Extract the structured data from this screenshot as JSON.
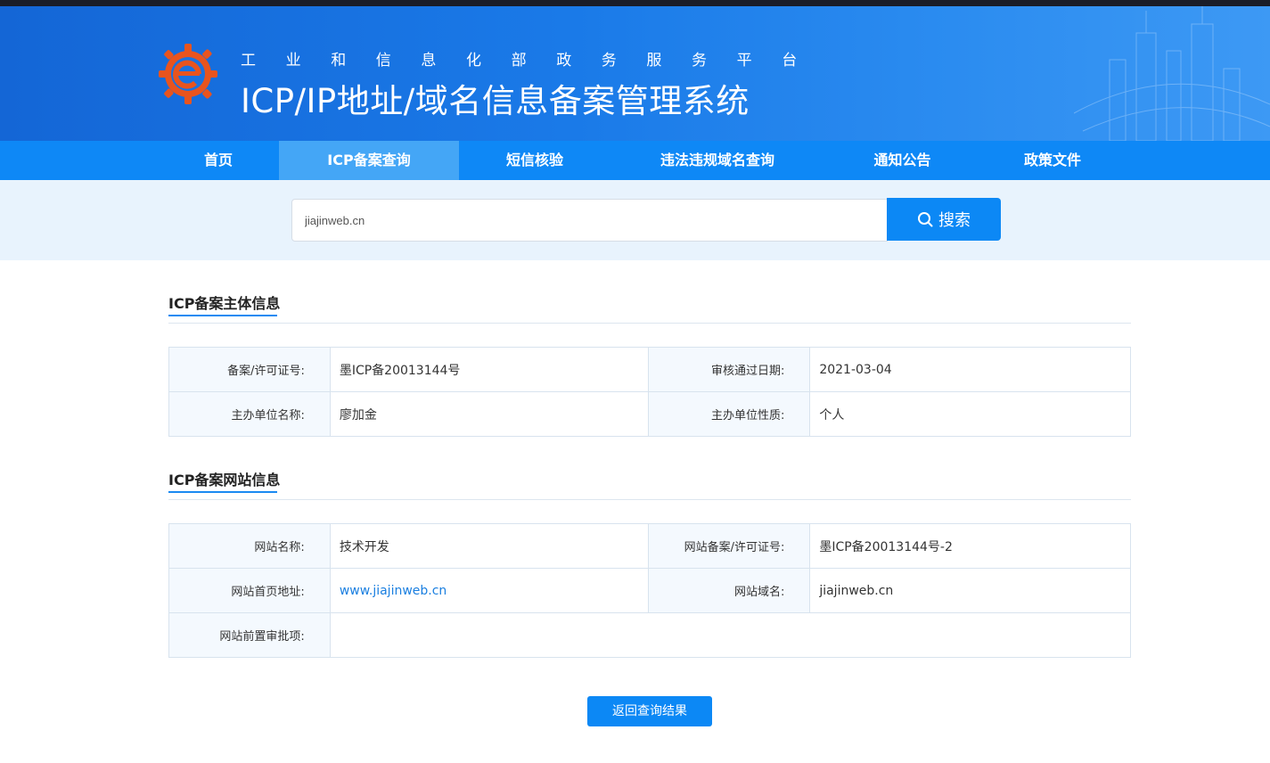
{
  "header": {
    "subtitle": "工业和信息化部政务服务平台",
    "title": "ICP/IP地址/域名信息备案管理系统"
  },
  "nav": {
    "items": [
      "首页",
      "ICP备案查询",
      "短信核验",
      "违法违规域名查询",
      "通知公告",
      "政策文件"
    ],
    "active": "ICP备案查询"
  },
  "search": {
    "value": "jiajinweb.cn",
    "button_label": "搜索"
  },
  "subject_section": {
    "title": "ICP备案主体信息",
    "license_label": "备案/许可证号:",
    "license_value": "墨ICP备20013144号",
    "approve_date_label": "审核通过日期:",
    "approve_date_value": "2021-03-04",
    "org_name_label": "主办单位名称:",
    "org_name_value": "廖加金",
    "org_type_label": "主办单位性质:",
    "org_type_value": "个人"
  },
  "site_section": {
    "title": "ICP备案网站信息",
    "site_name_label": "网站名称:",
    "site_name_value": "技术开发",
    "site_license_label": "网站备案/许可证号:",
    "site_license_value": "墨ICP备20013144号-2",
    "homepage_label": "网站首页地址:",
    "homepage_value": "www.jiajinweb.cn",
    "domain_label": "网站域名:",
    "domain_value": "jiajinweb.cn",
    "preapproval_label": "网站前置审批项:",
    "preapproval_value": ""
  },
  "back_button_label": "返回查询结果",
  "colors": {
    "nav_bg": "#0e88f6",
    "nav_active": "#44a6f6",
    "accent": "#0c88f5",
    "link": "#1a7fe0"
  }
}
